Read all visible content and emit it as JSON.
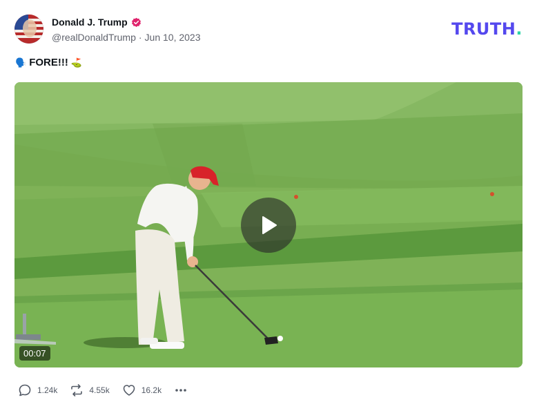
{
  "author": {
    "display_name": "Donald J. Trump",
    "handle": "@realDonaldTrump",
    "separator": "·",
    "date": "Jun 10, 2023",
    "verified": true
  },
  "brand": {
    "logo_text": "TRUTH",
    "logo_dot": ".",
    "logo_color": "#5448ee",
    "dot_color": "#2dd4a7"
  },
  "post": {
    "text": "FORE!!!",
    "leading_emoji": "🗣️",
    "trailing_emoji": "⛳"
  },
  "video": {
    "duration": "00:07",
    "thumbnail_icon": "golf-course-thumbnail"
  },
  "actions": {
    "replies": "1.24k",
    "retruths": "4.55k",
    "likes": "16.2k"
  },
  "colors": {
    "verified_badge": "#e0246d",
    "text_muted": "#60636d"
  }
}
